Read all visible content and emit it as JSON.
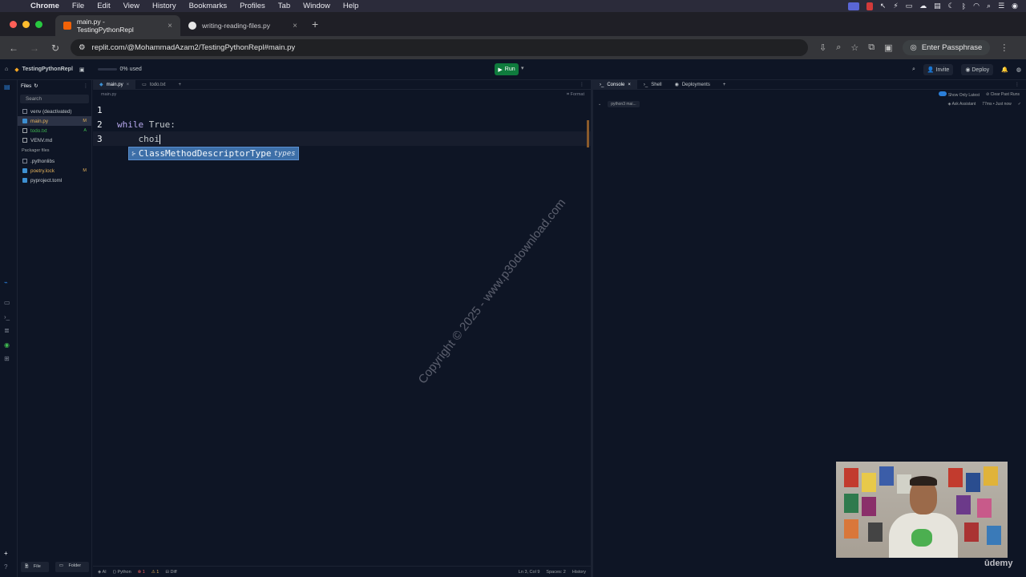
{
  "menubar": {
    "apple": "",
    "items": [
      "Chrome",
      "File",
      "Edit",
      "View",
      "History",
      "Bookmarks",
      "Profiles",
      "Tab",
      "Window",
      "Help"
    ]
  },
  "browser": {
    "tabs": [
      {
        "title": "main.py - TestingPythonRepl",
        "active": true
      },
      {
        "title": "writing-reading-files.py",
        "active": false
      }
    ],
    "url": "replit.com/@MohammadAzam2/TestingPythonRepl#main.py",
    "passphrase_button": "Enter Passphrase"
  },
  "replit": {
    "project_name": "TestingPythonRepl",
    "usage": "0% used",
    "run_label": "Run",
    "invite_label": "Invite",
    "deploy_label": "Deploy"
  },
  "files": {
    "header": "Files",
    "search_placeholder": "Search",
    "items": [
      {
        "name": "venv (deactivated)",
        "badge": ""
      },
      {
        "name": "main.py",
        "badge": "M"
      },
      {
        "name": "todo.txt",
        "badge": "A"
      },
      {
        "name": "VENV.md",
        "badge": ""
      }
    ],
    "packager_section": "Packager files",
    "packager_items": [
      {
        "name": ".pythonlibs",
        "badge": ""
      },
      {
        "name": "poetry.lock",
        "badge": "M"
      },
      {
        "name": "pyproject.toml",
        "badge": ""
      }
    ],
    "new_file": "File",
    "new_folder": "Folder"
  },
  "editor": {
    "tabs": [
      "main.py",
      "todo.txt"
    ],
    "breadcrumb": "main.py",
    "format_label": "Format",
    "lines": [
      {
        "num": "1",
        "code": ""
      },
      {
        "num": "2",
        "keyword": "while",
        "code": " True:"
      },
      {
        "num": "3",
        "code": "    choi"
      }
    ],
    "autocomplete": {
      "text": "ClassMethodDescriptorType",
      "module": "types"
    },
    "status": {
      "ai": "AI",
      "lang": "Python",
      "errors": "1",
      "warnings": "1",
      "diff": "Diff",
      "position": "Ln 3, Col 9",
      "spaces": "Spaces: 2",
      "history": "History"
    }
  },
  "console": {
    "tabs": [
      "Console",
      "Shell",
      "Deployments"
    ],
    "show_only_latest": "Show Only Latest",
    "clear_past_runs": "Clear Past Runs",
    "run_cmd": "python3 mai...",
    "ask_assistant": "Ask Assistant",
    "run_time": "77ms • Just now"
  },
  "watermark": "Copyright © 2025 - www.p30download.com",
  "brand": "ūdemy"
}
